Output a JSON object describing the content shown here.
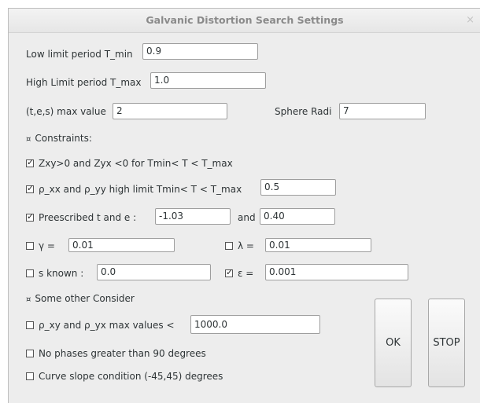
{
  "window": {
    "title": "Galvanic Distortion Search Settings",
    "close_glyph": "×"
  },
  "fields": {
    "tmin_label": "Low limit period T_min",
    "tmin_value": "0.9",
    "tmax_label": "High Limit period T_max",
    "tmax_value": "1.0",
    "tes_label": "(t,e,s) max value",
    "tes_value": "2",
    "sphere_label": "Sphere Radi",
    "sphere_value": "7"
  },
  "constraints": {
    "header": "Constraints:",
    "zxy_label": "Zxy>0 and Zyx <0 for Tmin< T < T_max",
    "zxy_checked": true,
    "rho_label": "ρ_xx and ρ_yy high limit Tmin< T < T_max",
    "rho_checked": true,
    "rho_value": "0.5",
    "prescribed_label": "Preescribed t and e :",
    "prescribed_checked": true,
    "prescribed_t": "-1.03",
    "and_label": "and",
    "prescribed_e": "0.40",
    "gamma_label": "γ =",
    "gamma_checked": false,
    "gamma_value": "0.01",
    "lambda_label": "λ =",
    "lambda_checked": false,
    "lambda_value": "0.01",
    "s_label": "s known :",
    "s_checked": false,
    "s_value": "0.0",
    "eps_label": "ε =",
    "eps_checked": true,
    "eps_value": "0.001"
  },
  "other": {
    "header": "Some other Consider",
    "rhomax_label": "ρ_xy and ρ_yx max values <",
    "rhomax_checked": false,
    "rhomax_value": "1000.0",
    "phase_label": "No phases greater than 90 degrees",
    "phase_checked": false,
    "slope_label": "Curve slope condition (-45,45) degrees",
    "slope_checked": false
  },
  "buttons": {
    "ok": "OK",
    "stop": "STOP"
  },
  "section_mark": "¤"
}
